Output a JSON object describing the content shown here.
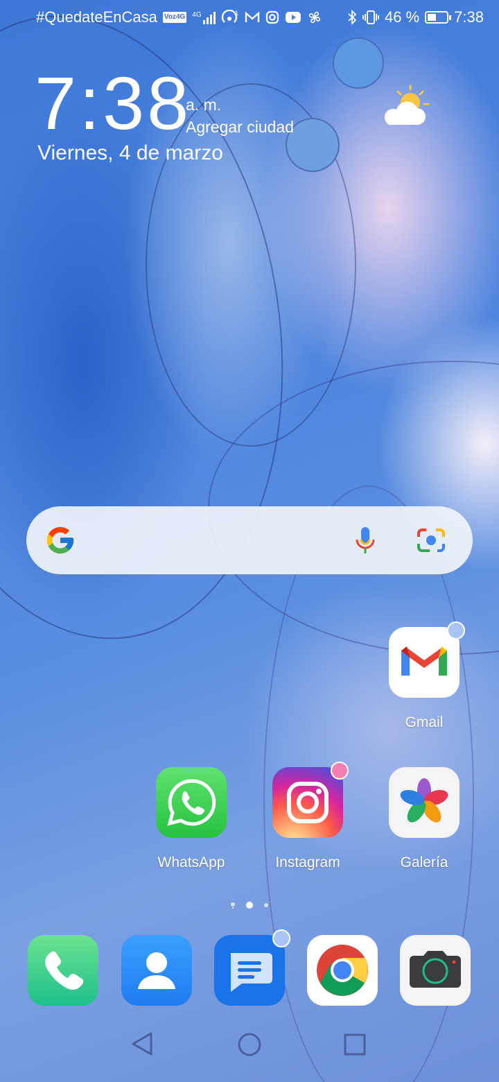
{
  "status_bar": {
    "carrier_text": "#QuedateEnCasa",
    "volte": "Voz4G",
    "network": "4G",
    "battery_percent": "46 %",
    "battery_level": 0.46,
    "time": "7:38",
    "icons": [
      "volte-icon",
      "4g-signal-icon",
      "hotspot-icon",
      "gmail-notification-icon",
      "instagram-notification-icon",
      "youtube-notification-icon",
      "fan-icon",
      "bluetooth-icon",
      "vibrate-icon",
      "battery-icon"
    ]
  },
  "clock_widget": {
    "time": "7:38",
    "ampm": "a. m.",
    "city_action": "Agregar ciudad",
    "date": "Viernes, 4 de marzo",
    "weather_icon": "partly-sunny-icon"
  },
  "search_bar": {
    "icons": [
      "google-g-icon",
      "microphone-icon",
      "google-lens-icon"
    ]
  },
  "home_apps": [
    {
      "label": "Gmail",
      "icon": "gmail-icon",
      "badge": true
    },
    {
      "label": "WhatsApp",
      "icon": "whatsapp-icon",
      "badge": false
    },
    {
      "label": "Instagram",
      "icon": "instagram-icon",
      "badge": true
    },
    {
      "label": "Galería",
      "icon": "gallery-icon",
      "badge": false
    }
  ],
  "page_indicator": {
    "pages": 3,
    "current": 2
  },
  "dock": [
    {
      "name": "phone",
      "icon": "phone-icon"
    },
    {
      "name": "contacts",
      "icon": "contacts-icon"
    },
    {
      "name": "messages",
      "icon": "messages-icon",
      "badge": true
    },
    {
      "name": "chrome",
      "icon": "chrome-icon"
    },
    {
      "name": "camera",
      "icon": "camera-icon"
    }
  ],
  "nav_bar": {
    "icons": [
      "back-icon",
      "home-icon",
      "recents-icon"
    ]
  },
  "colors": {
    "badge_blue": "#a8c4f5",
    "badge_pink": "#f27fb6",
    "status_text": "#ffffff"
  }
}
